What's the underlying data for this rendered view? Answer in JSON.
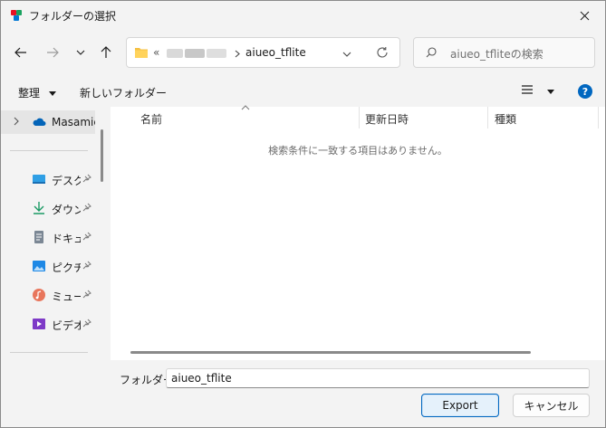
{
  "window": {
    "title": "フォルダーの選択"
  },
  "address_bar": {
    "overflow_marker": "«",
    "current_folder": "aiueo_tflite"
  },
  "search": {
    "placeholder": "aiueo_tfliteの検索"
  },
  "toolbar": {
    "organize": "整理",
    "new_folder": "新しいフォルダー"
  },
  "sidebar": {
    "items": [
      {
        "label": "Masamic",
        "icon": "onedrive-cloud-icon"
      },
      {
        "label": "デスクト",
        "icon": "desktop-icon",
        "pinned": true
      },
      {
        "label": "ダウン[",
        "icon": "download-icon",
        "pinned": true
      },
      {
        "label": "ドキュメ",
        "icon": "document-icon",
        "pinned": true
      },
      {
        "label": "ピクチャ",
        "icon": "picture-icon",
        "pinned": true
      },
      {
        "label": "ミュージ",
        "icon": "music-icon",
        "pinned": true
      },
      {
        "label": "ビデオ",
        "icon": "video-icon",
        "pinned": true
      }
    ]
  },
  "file_list": {
    "columns": [
      "名前",
      "更新日時",
      "種類"
    ],
    "empty_message": "検索条件に一致する項目はありません。"
  },
  "footer": {
    "folder_label": "フォルダー:",
    "folder_value": "aiueo_tflite",
    "export_label": "Export",
    "cancel_label": "キャンセル"
  },
  "colors": {
    "accent": "#0067c0",
    "folder": "#f5c043",
    "help": "#0067c0"
  }
}
